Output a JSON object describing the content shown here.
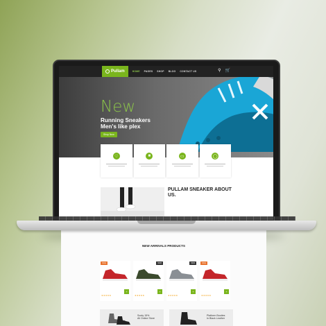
{
  "site": {
    "logo_text": "Pullam",
    "nav": [
      "HOME",
      "PAGES",
      "SHOP",
      "BLOG",
      "CONTACT US"
    ],
    "icons": [
      "search-icon",
      "cart-icon"
    ]
  },
  "hero": {
    "title": "New",
    "subtitle_line1": "Running Sneakers",
    "subtitle_line2": "Men's like plex",
    "button": "Shop Now",
    "accent": "#8bc34a"
  },
  "features": [
    {
      "icon": "heart-icon"
    },
    {
      "icon": "truck-icon"
    },
    {
      "icon": "card-icon"
    },
    {
      "icon": "headset-icon"
    }
  ],
  "about": {
    "title_line1": "PULLAM SNEAKER ABOUT",
    "title_line2": "US."
  },
  "new_arrivals": {
    "title": "NEW ARRIVALS PRODUCTS"
  },
  "products": [
    {
      "tag": "SALE",
      "tag_type": "sale",
      "color": "#c4262b",
      "stars": "★★★★★"
    },
    {
      "tag": "NEW",
      "tag_type": "new",
      "color": "#3b4a2d",
      "stars": "★★★★★"
    },
    {
      "tag": "NEW",
      "tag_type": "new",
      "color": "#8a8f94",
      "stars": "★★★★★"
    },
    {
      "tag": "SALE",
      "tag_type": "sale",
      "color": "#c4262b",
      "stars": "★★★★★"
    }
  ],
  "banners": [
    {
      "line1": "Sooty 15%",
      "line2": "All Online Store"
    },
    {
      "line1": "Platform Booties",
      "line2": "In Black Leather"
    }
  ]
}
